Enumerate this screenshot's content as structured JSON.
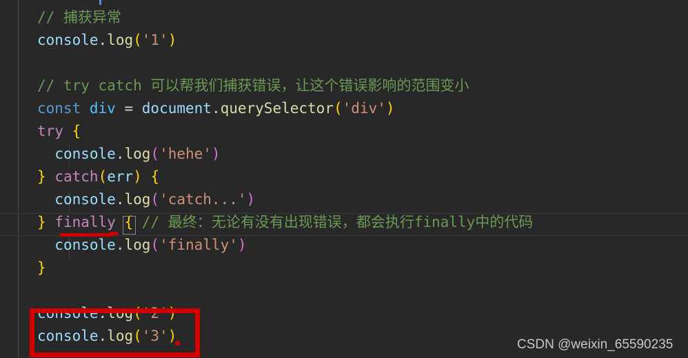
{
  "editor": {
    "theme_name": "dark-plus",
    "background": "#282828",
    "gutter_background": "#282828",
    "watermark": "CSDN @weixin_65590235",
    "colors": {
      "comment": "#6A9955",
      "keyword": "#569CD6",
      "control_keyword": "#C586C0",
      "variable": "#4FC1FF",
      "object": "#9CDCFE",
      "function": "#DCDCAA",
      "string": "#CE9178",
      "bracket_yellow": "#FFD700",
      "bracket_purple": "#DA70D6",
      "annotation_red": "#d40000"
    },
    "lines": [
      {
        "id": "line-comment-catch-exception",
        "tokens": [
          {
            "text": "// 捕获异常",
            "cls": "t-comment"
          }
        ]
      },
      {
        "id": "line-console-log-1",
        "tokens": [
          {
            "text": "console",
            "cls": "t-obj"
          },
          {
            "text": ".",
            "cls": "t-punct"
          },
          {
            "text": "log",
            "cls": "t-fn"
          },
          {
            "text": "(",
            "cls": "t-paren-y"
          },
          {
            "text": "'1'",
            "cls": "t-str"
          },
          {
            "text": ")",
            "cls": "t-paren-y"
          }
        ]
      },
      {
        "id": "line-blank-1",
        "tokens": []
      },
      {
        "id": "line-comment-try-catch",
        "tokens": [
          {
            "text": "// try catch 可以帮我们捕获错误，让这个错误影响的范围变小",
            "cls": "t-comment"
          }
        ]
      },
      {
        "id": "line-const-div",
        "tokens": [
          {
            "text": "const",
            "cls": "t-kw"
          },
          {
            "text": " ",
            "cls": "t-punct"
          },
          {
            "text": "div",
            "cls": "t-var"
          },
          {
            "text": " ",
            "cls": "t-punct"
          },
          {
            "text": "=",
            "cls": "t-op"
          },
          {
            "text": " ",
            "cls": "t-punct"
          },
          {
            "text": "document",
            "cls": "t-obj"
          },
          {
            "text": ".",
            "cls": "t-punct"
          },
          {
            "text": "querySelector",
            "cls": "t-fn"
          },
          {
            "text": "(",
            "cls": "t-paren-y"
          },
          {
            "text": "'div'",
            "cls": "t-str"
          },
          {
            "text": ")",
            "cls": "t-paren-y"
          }
        ]
      },
      {
        "id": "line-try-open",
        "tokens": [
          {
            "text": "try",
            "cls": "t-ctl"
          },
          {
            "text": " ",
            "cls": "t-punct"
          },
          {
            "text": "{",
            "cls": "t-brace-y"
          }
        ]
      },
      {
        "id": "line-console-log-hehe",
        "indent": 2,
        "tokens": [
          {
            "text": "  ",
            "cls": "t-punct"
          },
          {
            "text": "console",
            "cls": "t-obj"
          },
          {
            "text": ".",
            "cls": "t-punct"
          },
          {
            "text": "log",
            "cls": "t-fn"
          },
          {
            "text": "(",
            "cls": "t-paren-p"
          },
          {
            "text": "'hehe'",
            "cls": "t-str"
          },
          {
            "text": ")",
            "cls": "t-paren-p"
          }
        ]
      },
      {
        "id": "line-catch-err",
        "tokens": [
          {
            "text": "}",
            "cls": "t-brace-y"
          },
          {
            "text": " ",
            "cls": "t-punct"
          },
          {
            "text": "catch",
            "cls": "t-ctl"
          },
          {
            "text": "(",
            "cls": "t-paren-y"
          },
          {
            "text": "err",
            "cls": "t-obj"
          },
          {
            "text": ")",
            "cls": "t-paren-y"
          },
          {
            "text": " ",
            "cls": "t-punct"
          },
          {
            "text": "{",
            "cls": "t-brace-y"
          }
        ]
      },
      {
        "id": "line-console-log-catch",
        "indent": 2,
        "tokens": [
          {
            "text": "  ",
            "cls": "t-punct"
          },
          {
            "text": "console",
            "cls": "t-obj"
          },
          {
            "text": ".",
            "cls": "t-punct"
          },
          {
            "text": "log",
            "cls": "t-fn"
          },
          {
            "text": "(",
            "cls": "t-paren-p"
          },
          {
            "text": "'catch...'",
            "cls": "t-str"
          },
          {
            "text": ")",
            "cls": "t-paren-p"
          }
        ]
      },
      {
        "id": "line-finally-open",
        "tokens": [
          {
            "text": "}",
            "cls": "t-brace-y"
          },
          {
            "text": " ",
            "cls": "t-punct"
          },
          {
            "text": "finally",
            "cls": "t-ctl"
          },
          {
            "text": " ",
            "cls": "t-punct"
          },
          {
            "text": "{",
            "cls": "t-brace-y"
          },
          {
            "text": " ",
            "cls": "t-punct"
          },
          {
            "text": "// 最终：无论有没有出现错误，都会执行finally中的代码",
            "cls": "t-comment"
          }
        ]
      },
      {
        "id": "line-console-log-finally",
        "indent": 2,
        "tokens": [
          {
            "text": "  ",
            "cls": "t-punct"
          },
          {
            "text": "console",
            "cls": "t-obj"
          },
          {
            "text": ".",
            "cls": "t-punct"
          },
          {
            "text": "log",
            "cls": "t-fn"
          },
          {
            "text": "(",
            "cls": "t-paren-p"
          },
          {
            "text": "'finally'",
            "cls": "t-str"
          },
          {
            "text": ")",
            "cls": "t-paren-p"
          }
        ]
      },
      {
        "id": "line-finally-close",
        "tokens": [
          {
            "text": "}",
            "cls": "t-brace-y"
          }
        ]
      },
      {
        "id": "line-blank-2",
        "tokens": []
      },
      {
        "id": "line-console-log-2",
        "tokens": [
          {
            "text": "console",
            "cls": "t-obj"
          },
          {
            "text": ".",
            "cls": "t-punct"
          },
          {
            "text": "log",
            "cls": "t-fn"
          },
          {
            "text": "(",
            "cls": "t-paren-y"
          },
          {
            "text": "'2'",
            "cls": "t-str"
          },
          {
            "text": ")",
            "cls": "t-paren-y"
          }
        ]
      },
      {
        "id": "line-console-log-3",
        "tokens": [
          {
            "text": "console",
            "cls": "t-obj"
          },
          {
            "text": ".",
            "cls": "t-punct"
          },
          {
            "text": "log",
            "cls": "t-fn"
          },
          {
            "text": "(",
            "cls": "t-paren-y"
          },
          {
            "text": "'3'",
            "cls": "t-str"
          },
          {
            "text": ")",
            "cls": "t-paren-y"
          }
        ]
      }
    ],
    "annotations": {
      "underline_target": "finally",
      "box_targets": [
        "console.log('2')",
        "console.log('3')"
      ]
    }
  }
}
